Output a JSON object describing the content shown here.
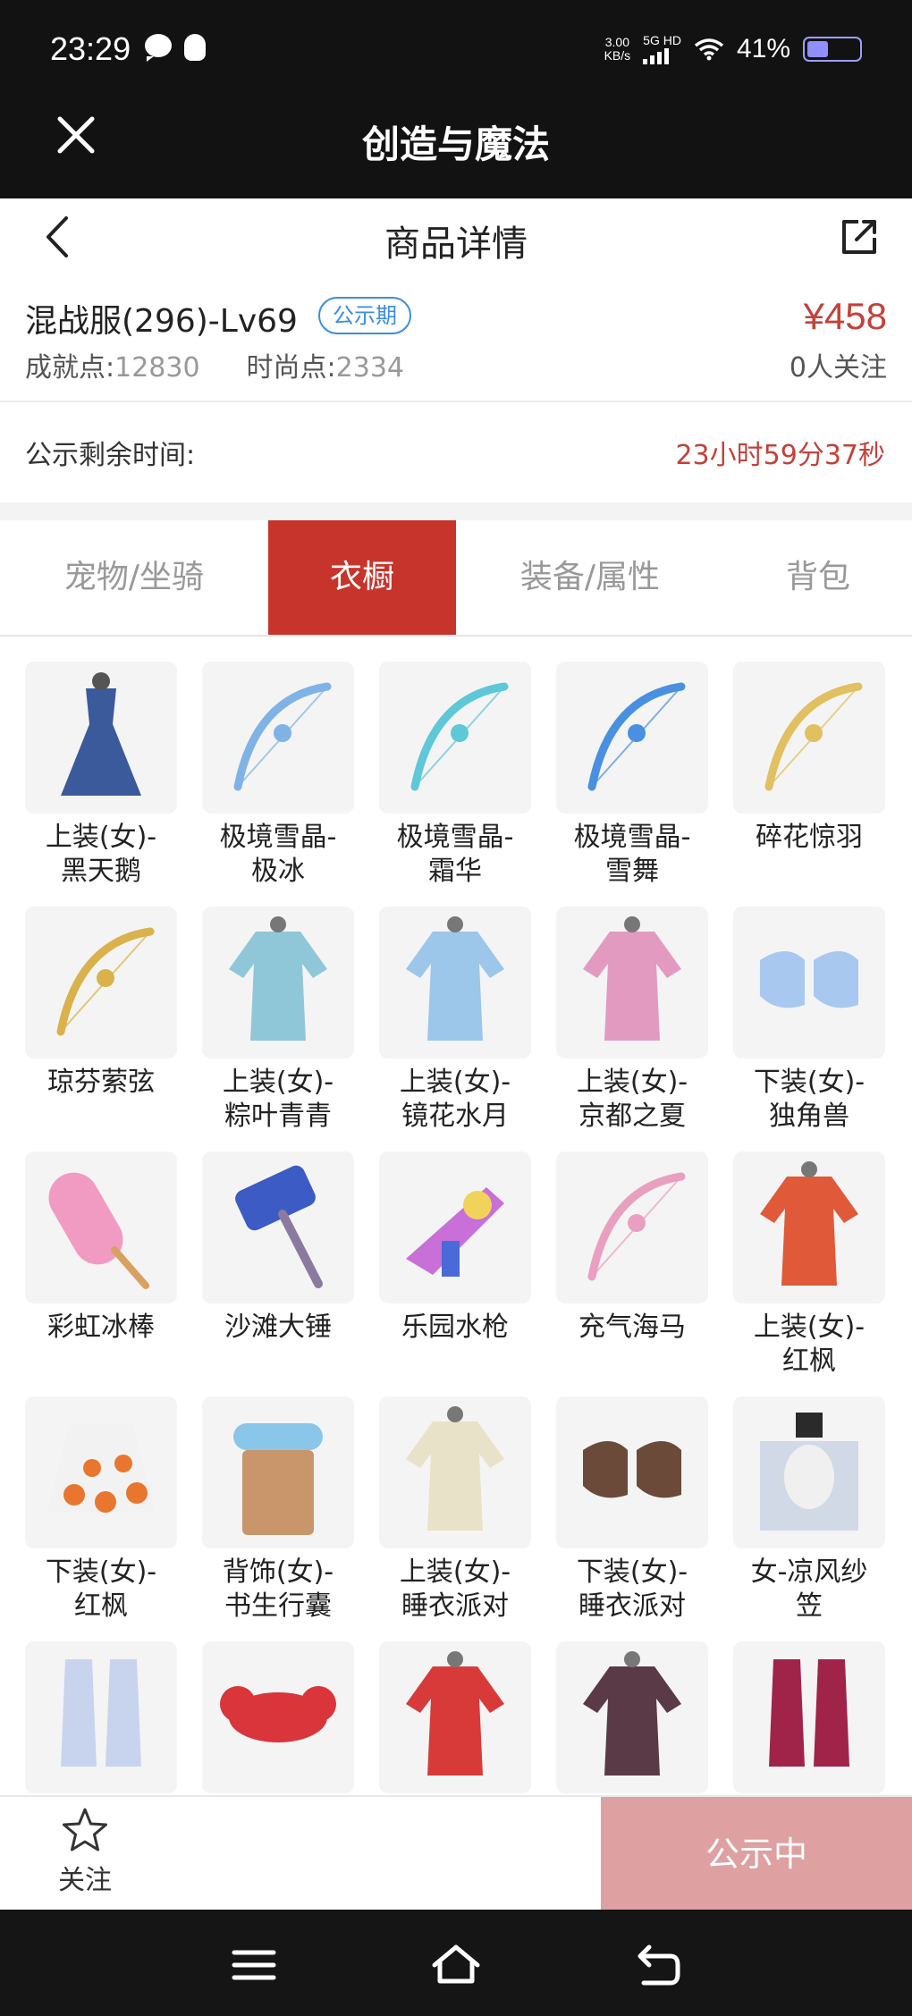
{
  "status_bar": {
    "time": "23:29",
    "net_speed": "3.00",
    "net_speed_unit": "KB/s",
    "network": "5G HD",
    "battery": "41%"
  },
  "app": {
    "title": "创造与魔法"
  },
  "page": {
    "title": "商品详情"
  },
  "product": {
    "name": "混战服(296)-Lv69",
    "badge": "公示期",
    "achievement_label": "成就点:",
    "achievement_value": "12830",
    "fashion_label": "时尚点:",
    "fashion_value": "2334",
    "price": "¥458",
    "watchers": "0人关注"
  },
  "countdown": {
    "label": "公示剩余时间:",
    "value": "23小时59分37秒"
  },
  "tabs": [
    {
      "label": "宠物/坐骑",
      "active": false
    },
    {
      "label": "衣橱",
      "active": true
    },
    {
      "label": "装备/属性",
      "active": false
    },
    {
      "label": "背包",
      "active": false
    }
  ],
  "items": [
    {
      "label": "上装(女)-\n黑天鹅",
      "icon": "dress-icon",
      "color": "#3a5a9c"
    },
    {
      "label": "极境雪晶-\n极冰",
      "icon": "bow-icon",
      "color": "#7fb3e6"
    },
    {
      "label": "极境雪晶-\n霜华",
      "icon": "bow-icon",
      "color": "#5ec7d8"
    },
    {
      "label": "极境雪晶-\n雪舞",
      "icon": "bow-icon",
      "color": "#4a90e0"
    },
    {
      "label": "碎花惊羽",
      "icon": "bow-icon",
      "color": "#e0c060"
    },
    {
      "label": "琼芬萦弦",
      "icon": "bow-icon",
      "color": "#d9b24c"
    },
    {
      "label": "上装(女)-\n粽叶青青",
      "icon": "outfit-icon",
      "color": "#8fc7d9"
    },
    {
      "label": "上装(女)-\n镜花水月",
      "icon": "outfit-icon",
      "color": "#9cc6ea"
    },
    {
      "label": "上装(女)-\n京都之夏",
      "icon": "outfit-icon",
      "color": "#e29ac0"
    },
    {
      "label": "下装(女)-\n独角兽",
      "icon": "shoes-icon",
      "color": "#a9c8f0"
    },
    {
      "label": "彩虹冰棒",
      "icon": "popsicle-icon",
      "color": "#f29bc2"
    },
    {
      "label": "沙滩大锤",
      "icon": "hammer-icon",
      "color": "#3c5bc4"
    },
    {
      "label": "乐园水枪",
      "icon": "watergun-icon",
      "color": "#c86fd8"
    },
    {
      "label": "充气海马",
      "icon": "bow-icon",
      "color": "#e9a0c0"
    },
    {
      "label": "上装(女)-\n红枫",
      "icon": "outfit-icon",
      "color": "#e05a3a"
    },
    {
      "label": "下装(女)-\n红枫",
      "icon": "skirt-icon",
      "color": "#e8762e"
    },
    {
      "label": "背饰(女)-\n书生行囊",
      "icon": "backpack-icon",
      "color": "#c9956a"
    },
    {
      "label": "上装(女)-\n睡衣派对",
      "icon": "outfit-icon",
      "color": "#e8e2c8"
    },
    {
      "label": "下装(女)-\n睡衣派对",
      "icon": "shoes-icon",
      "color": "#6b4a3a"
    },
    {
      "label": "女-凉风纱\n笠",
      "icon": "hat-icon",
      "color": "#2a2a2a"
    },
    {
      "label": "",
      "icon": "boots-icon",
      "color": "#c8d4ee"
    },
    {
      "label": "",
      "icon": "lobster-icon",
      "color": "#d9353a"
    },
    {
      "label": "",
      "icon": "outfit-icon",
      "color": "#d83a3a"
    },
    {
      "label": "",
      "icon": "outfit-icon",
      "color": "#5a3a46"
    },
    {
      "label": "",
      "icon": "boots-icon",
      "color": "#a0244a"
    }
  ],
  "action_bar": {
    "favorite_label": "关注",
    "cta_label": "公示中"
  }
}
